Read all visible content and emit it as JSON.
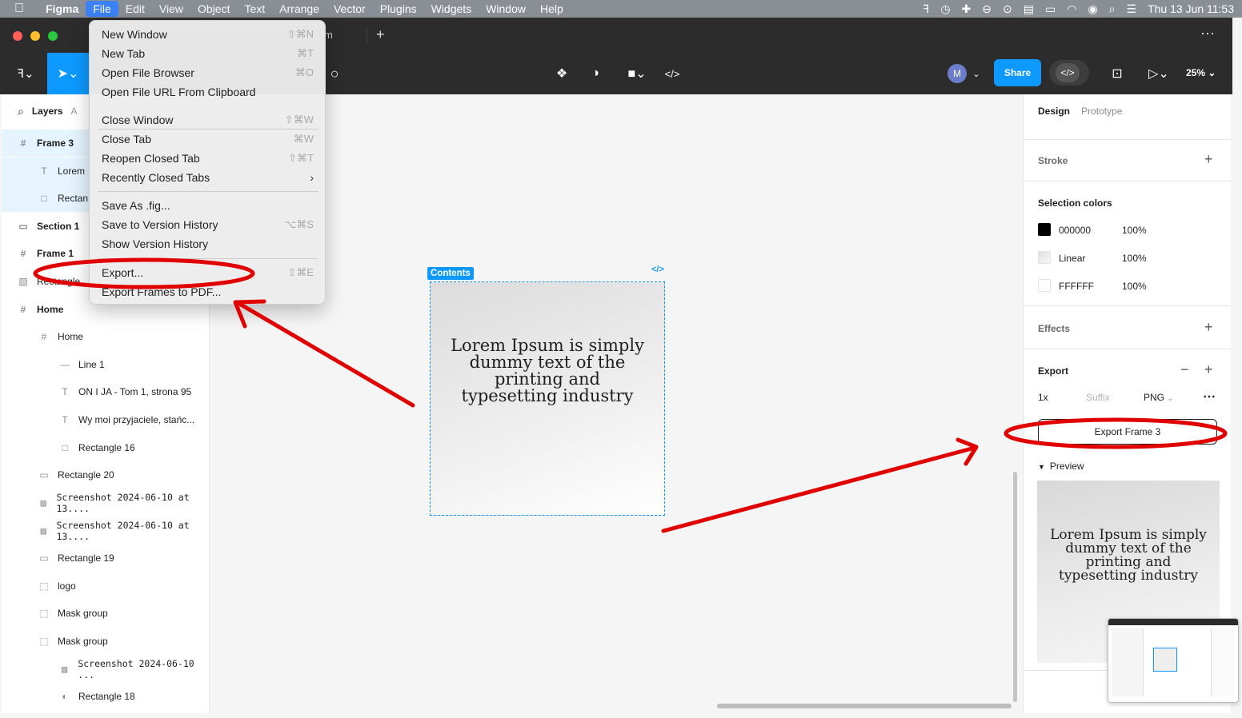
{
  "menubar": {
    "app": "Figma",
    "items": [
      "File",
      "Edit",
      "View",
      "Object",
      "Text",
      "Arrange",
      "Vector",
      "Plugins",
      "Widgets",
      "Window",
      "Help"
    ],
    "datetime": "Thu 13 Jun  11:53"
  },
  "tabbar": {
    "tab_fragment": "m"
  },
  "toolbar": {
    "avatar_initial": "M",
    "share_label": "Share",
    "zoom": "25%"
  },
  "layers_panel": {
    "tab_layers": "Layers",
    "tab_assets": "A",
    "items": [
      {
        "name": "Frame 3",
        "icon": "#"
      },
      {
        "name": "Lorem",
        "icon": "T"
      },
      {
        "name": "Rectan",
        "icon": "□"
      },
      {
        "name": "Section 1",
        "icon": "▭"
      },
      {
        "name": "Frame 1",
        "icon": "#"
      },
      {
        "name": "Rectangle",
        "icon": "▨"
      },
      {
        "name": "Home",
        "icon": "#"
      },
      {
        "name": "Home",
        "icon": "#"
      },
      {
        "name": "Line 1",
        "icon": "—"
      },
      {
        "name": "ON I JA - Tom 1, strona 95",
        "icon": "T"
      },
      {
        "name": "Wy moi przyjaciele, stańc...",
        "icon": "T"
      },
      {
        "name": "Rectangle 16",
        "icon": "□"
      },
      {
        "name": "Rectangle 20",
        "icon": "▭"
      },
      {
        "name": "Screenshot 2024-06-10 at 13....",
        "icon": "▨"
      },
      {
        "name": "Screenshot 2024-06-10 at 13....",
        "icon": "▨"
      },
      {
        "name": "Rectangle 19",
        "icon": "▭"
      },
      {
        "name": "logo",
        "icon": "⬚"
      },
      {
        "name": "Mask group",
        "icon": "⬚"
      },
      {
        "name": "Mask group",
        "icon": "⬚"
      },
      {
        "name": "Screenshot 2024-06-10 ...",
        "icon": "▨"
      },
      {
        "name": "Rectangle 18",
        "icon": "◐"
      }
    ]
  },
  "file_menu": {
    "items": [
      {
        "label": "New Window",
        "shortcut": "⇧⌘N"
      },
      {
        "label": "New Tab",
        "shortcut": "⌘T"
      },
      {
        "label": "Open File Browser",
        "shortcut": "⌘O"
      },
      {
        "label": "Open File URL From Clipboard",
        "shortcut": ""
      },
      {
        "label": "Close Window",
        "shortcut": "⇧⌘W"
      },
      {
        "label": "Close Tab",
        "shortcut": "⌘W"
      },
      {
        "label": "Reopen Closed Tab",
        "shortcut": "⇧⌘T"
      },
      {
        "label": "Recently Closed Tabs",
        "shortcut": "›"
      },
      {
        "label": "Save As .fig...",
        "shortcut": ""
      },
      {
        "label": "Save to Version History",
        "shortcut": "⌥⌘S"
      },
      {
        "label": "Show Version History",
        "shortcut": ""
      },
      {
        "label": "Export...",
        "shortcut": "⇧⌘E"
      },
      {
        "label": "Export Frames to PDF...",
        "shortcut": ""
      }
    ]
  },
  "canvas": {
    "frame_label": "Contents",
    "code_badge": "</>",
    "frame_text": "Lorem Ipsum is simply dummy text of the printing and typesetting industry"
  },
  "design_panel": {
    "tab_design": "Design",
    "tab_prototype": "Prototype",
    "stroke_title": "Stroke",
    "selection_colors_title": "Selection colors",
    "selection_colors": [
      {
        "name": "000000",
        "opacity": "100%",
        "color": "#000000"
      },
      {
        "name": "Linear",
        "opacity": "100%",
        "color": "#eeeeee"
      },
      {
        "name": "FFFFFF",
        "opacity": "100%",
        "color": "#ffffff"
      }
    ],
    "effects_title": "Effects",
    "export_title": "Export",
    "export_scale": "1x",
    "export_suffix_placeholder": "Suffix",
    "export_format": "PNG",
    "export_button": "Export Frame 3",
    "preview_label": "Preview",
    "preview_text": "Lorem Ipsum is simply dummy text of the printing and typesetting industry"
  },
  "colors": {
    "accent": "#0d99ff",
    "annotation": "#e00000"
  }
}
